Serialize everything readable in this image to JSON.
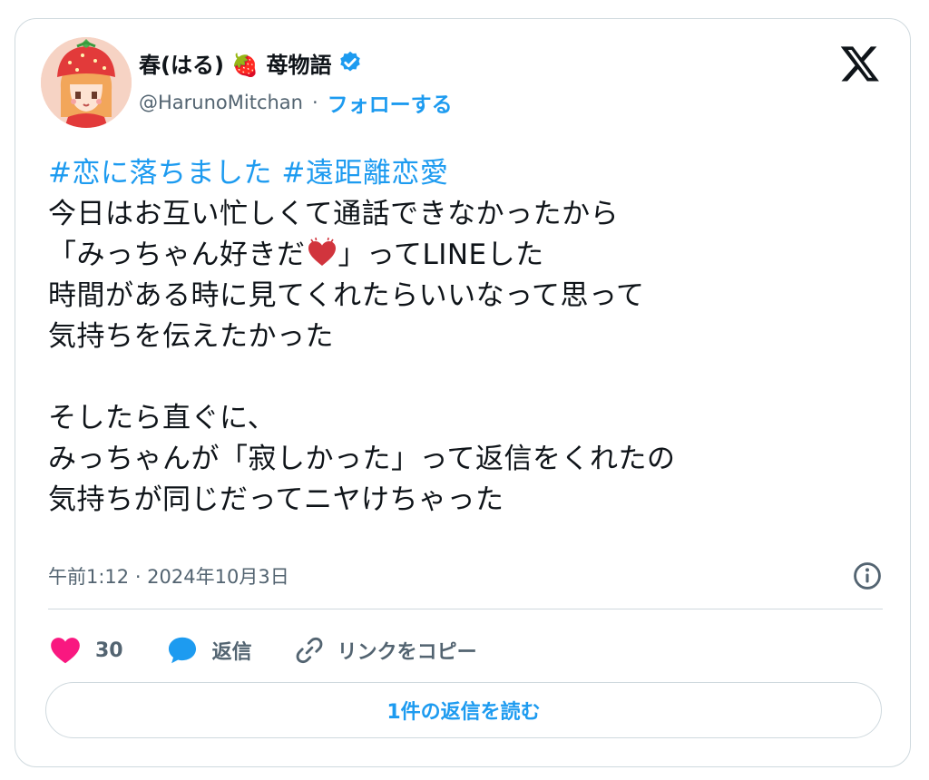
{
  "author": {
    "display_name": "春(はる) 🍓 苺物語",
    "handle": "@HarunoMitchan",
    "separator": "·",
    "follow_label": "フォローする",
    "verified": true,
    "avatar_icon": "strawberry-girl-avatar"
  },
  "tweet": {
    "hashtags": [
      "#恋に落ちました",
      "#遠距離恋愛"
    ],
    "lines": [
      "今日はお互い忙しくて通話できなかったから",
      "「みっちゃん好きだ",
      "」ってLINEした",
      "時間がある時に見てくれたらいいなって思って",
      "気持ちを伝えたかった",
      "そしたら直ぐに、",
      "みっちゃんが「寂しかった」って返信をくれたの",
      "気持ちが同じだってニヤけちゃった"
    ],
    "emoji": "beating-heart-icon"
  },
  "meta": {
    "timestamp": "午前1:12 · 2024年10月3日"
  },
  "actions": {
    "like_count": "30",
    "reply_label": "返信",
    "copy_link_label": "リンクをコピー"
  },
  "read_replies_label": "1件の返信を読む",
  "colors": {
    "accent": "#1d9bf0",
    "like_red": "#f91880",
    "heart_fill": "#d1343d",
    "text": "#0f1419",
    "muted": "#536471",
    "border": "#cfd9de"
  }
}
